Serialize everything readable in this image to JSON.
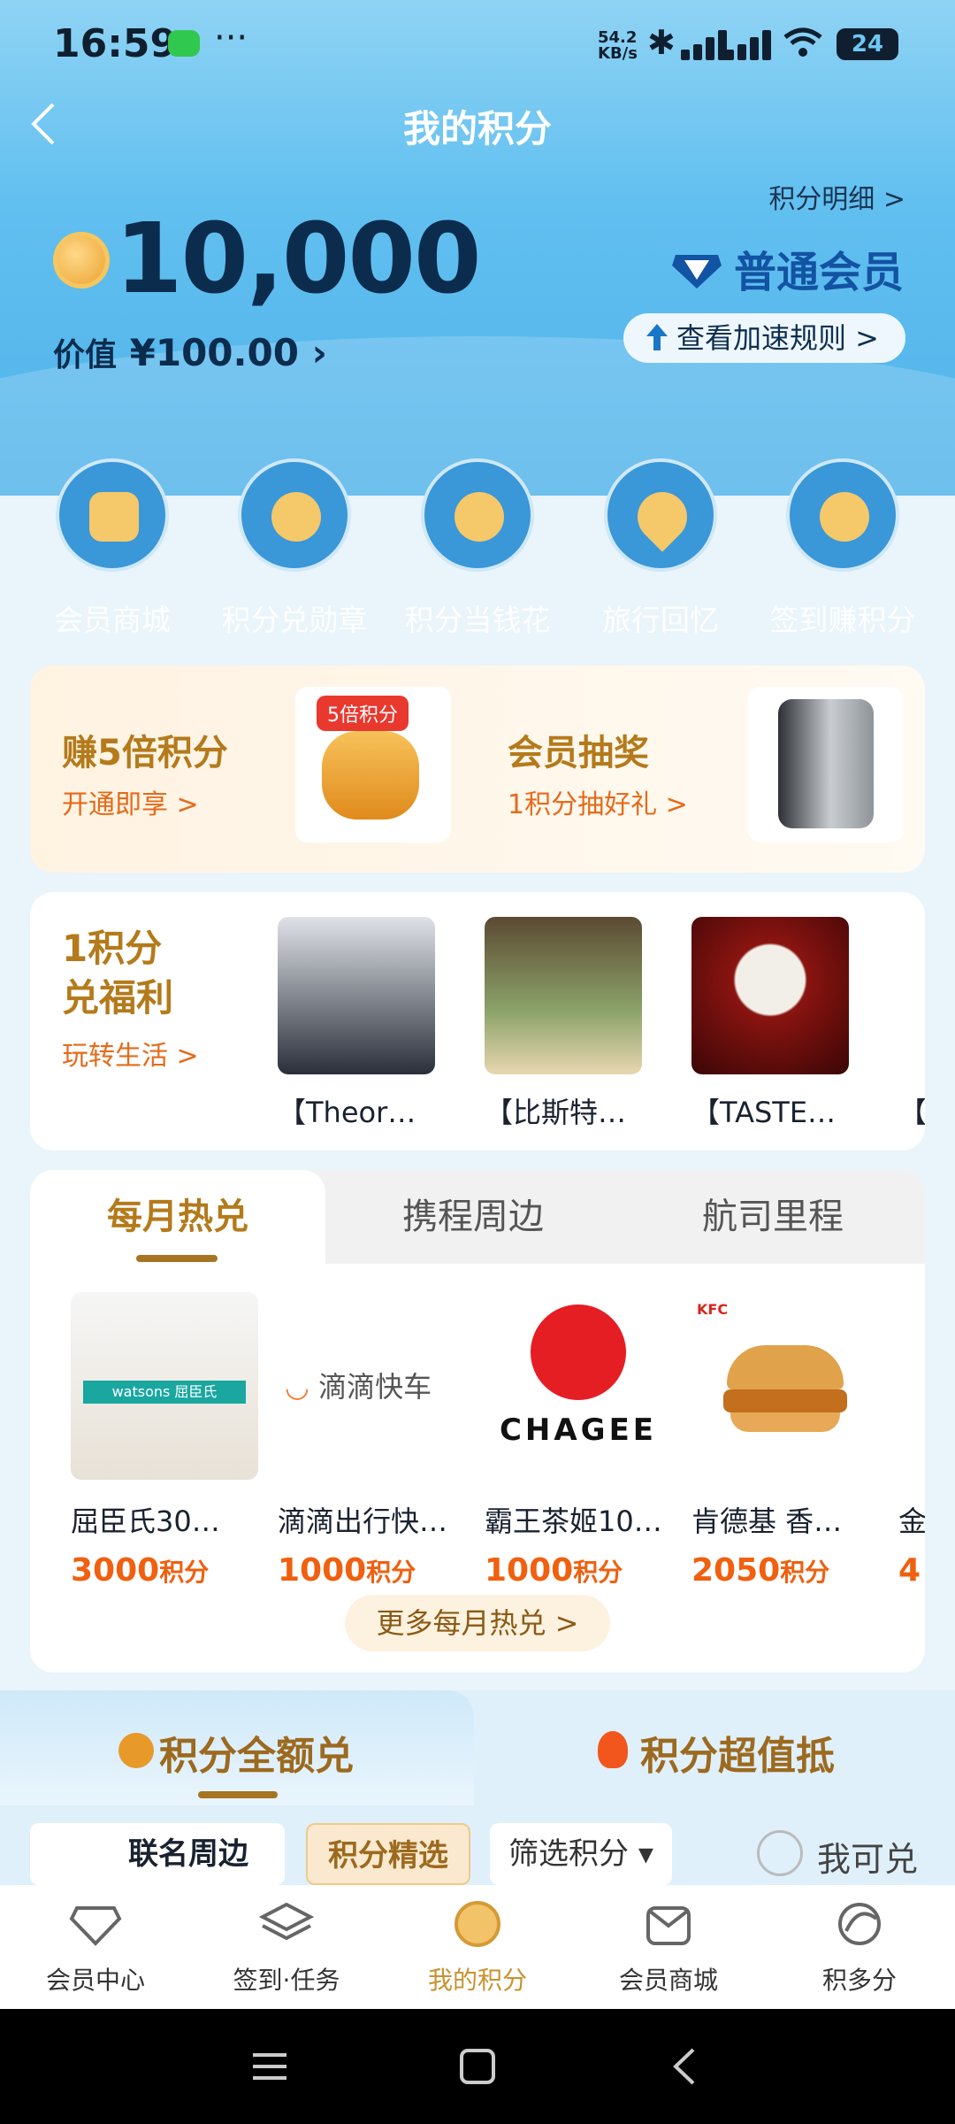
{
  "status_bar": {
    "time": "16:59",
    "network_speed": "54.2\nKB/s",
    "battery": "24"
  },
  "header": {
    "title": "我的积分",
    "detail_link": "积分明细 >",
    "points": "10,000",
    "value_label": "价值",
    "value_amount": "¥100.00",
    "member_level": "普通会员",
    "speed_rules": "查看加速规则 >"
  },
  "quick_actions": [
    {
      "label": "会员商城",
      "icon": "member-mall-icon"
    },
    {
      "label": "积分兑勋章",
      "icon": "medal-icon"
    },
    {
      "label": "积分当钱花",
      "icon": "points-coin-icon"
    },
    {
      "label": "旅行回忆",
      "icon": "map-pin-icon"
    },
    {
      "label": "签到赚积分",
      "icon": "coin-stack-icon"
    }
  ],
  "promo": {
    "left_title": "赚5倍积分",
    "left_sub": "开通即享 >",
    "left_tag": "5倍积分",
    "right_title": "会员抽奖",
    "right_sub": "1积分抽好礼 >"
  },
  "benefits": {
    "heading_line1": "1积分",
    "heading_line2": "兑福利",
    "link": "玩转生活 >",
    "items": [
      {
        "caption": "【Theor…"
      },
      {
        "caption": "【比斯特…"
      },
      {
        "caption": "【TASTE…"
      },
      {
        "caption": "【"
      }
    ]
  },
  "hot": {
    "tabs": [
      "每月热兑",
      "携程周边",
      "航司里程"
    ],
    "products": [
      {
        "name": "屈臣氏30…",
        "price": "3000",
        "unit": "积分",
        "brand": "watsons 屈臣氏"
      },
      {
        "name": "滴滴出行快…",
        "price": "1000",
        "unit": "积分",
        "brand": "滴滴快车"
      },
      {
        "name": "霸王茶姬10…",
        "price": "1000",
        "unit": "积分",
        "brand": "CHAGEE"
      },
      {
        "name": "肯德基 香…",
        "price": "2050",
        "unit": "积分",
        "brand": "KFC"
      },
      {
        "name": "金",
        "price": "4",
        "unit": "",
        "brand": ""
      }
    ],
    "more_button": "更多每月热兑 >"
  },
  "exchange_tabs": {
    "left": "积分全额兑",
    "right": "积分超值抵"
  },
  "filters": {
    "chip_a": "联名周边",
    "chip_b": "积分精选",
    "chip_c": "筛选积分 ▾",
    "can_exchange": "我可兑"
  },
  "bottom_nav": [
    {
      "label": "会员中心",
      "icon": "diamond-icon"
    },
    {
      "label": "签到·任务",
      "icon": "layers-icon"
    },
    {
      "label": "我的积分",
      "icon": "points-coin-icon"
    },
    {
      "label": "会员商城",
      "icon": "mall-icon"
    },
    {
      "label": "积多分",
      "icon": "dolphin-icon"
    }
  ],
  "colors": {
    "accent_gold": "#b47a1b",
    "price_orange": "#f0600f",
    "header_blue": "#62c0f0"
  }
}
